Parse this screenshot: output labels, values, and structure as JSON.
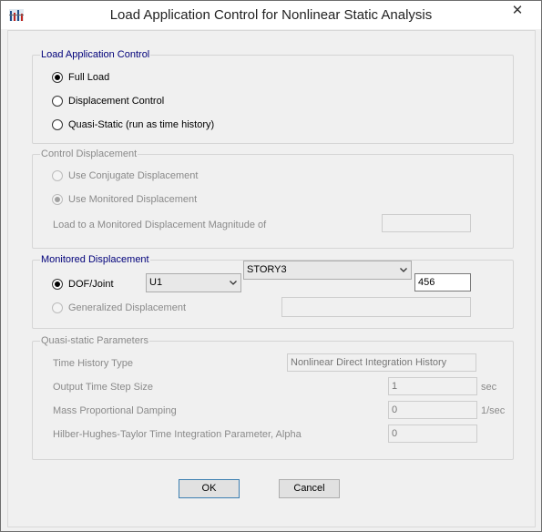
{
  "window": {
    "title": "Load Application Control for Nonlinear Static Analysis",
    "close_glyph": "✕"
  },
  "load_application": {
    "legend": "Load Application Control",
    "options": [
      {
        "label": "Full Load",
        "selected": true
      },
      {
        "label": "Displacement Control",
        "selected": false
      },
      {
        "label": "Quasi-Static (run as time history)",
        "selected": false
      }
    ]
  },
  "control_displacement": {
    "legend": "Control Displacement",
    "use_conjugate": "Use Conjugate Displacement",
    "use_monitored": "Use Monitored Displacement",
    "magnitude_label": "Load to a Monitored Displacement Magnitude of",
    "magnitude_value": ""
  },
  "monitored_displacement": {
    "legend": "Monitored Displacement",
    "dof_label": "DOF/Joint",
    "dof_value": "U1",
    "story_value": "STORY3",
    "joint_value": "456",
    "generalized_label": "Generalized Displacement",
    "generalized_value": ""
  },
  "quasi_static": {
    "legend": "Quasi-static Parameters",
    "time_history_type_label": "Time History Type",
    "time_history_type_value": "Nonlinear Direct Integration History",
    "output_step_label": "Output Time Step Size",
    "output_step_value": "1",
    "output_step_unit": "sec",
    "mass_damping_label": "Mass Proportional Damping",
    "mass_damping_value": "0",
    "mass_damping_unit": "1/sec",
    "hht_label": "Hilber-Hughes-Taylor Time Integration Parameter, Alpha",
    "hht_value": "0"
  },
  "buttons": {
    "ok": "OK",
    "cancel": "Cancel"
  },
  "icons": {
    "app": "app-icon",
    "dropdown": "chevron-down-icon"
  }
}
